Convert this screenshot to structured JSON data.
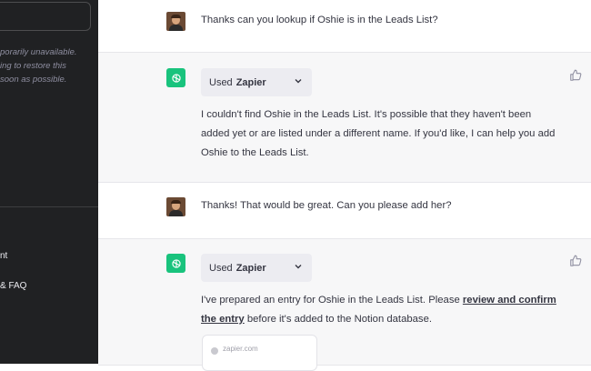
{
  "sidebar": {
    "notice_lines": [
      "porarily unavailable.",
      "ing to restore this",
      "soon as possible."
    ],
    "items": [
      {
        "label": "nt"
      },
      {
        "label": "& FAQ"
      }
    ]
  },
  "conversation": {
    "user_message_1": "Thanks can you lookup if Oshie is in the Leads List?",
    "bot_message_1": {
      "plugin_prefix": "Used",
      "plugin_name": "Zapier",
      "text": "I couldn't find Oshie in the Leads List. It's possible that they haven't been added yet or are listed under a different name. If you'd like, I can help you add Oshie to the Leads List."
    },
    "user_message_2": "Thanks! That would be great. Can you please add her?",
    "bot_message_2": {
      "plugin_prefix": "Used",
      "plugin_name": "Zapier",
      "text_before": "I've prepared an entry for Oshie in the Leads List. Please ",
      "link_text": "review and confirm the entry",
      "text_after": " before it's added to the Notion database."
    },
    "link_card": {
      "domain": "zapier.com"
    }
  },
  "colors": {
    "sidebar_bg": "#202123",
    "bot_row_bg": "#f7f7f8",
    "bot_avatar": "#19c37d",
    "chip_bg": "#ececf1"
  }
}
